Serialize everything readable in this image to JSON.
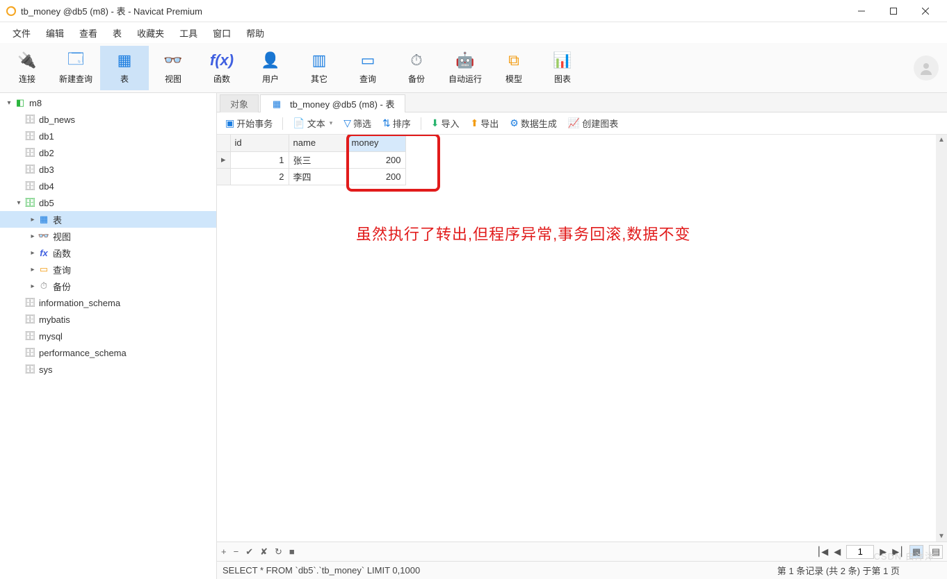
{
  "window": {
    "title": "tb_money @db5 (m8) - 表 - Navicat Premium"
  },
  "menu": [
    "文件",
    "编辑",
    "查看",
    "表",
    "收藏夹",
    "工具",
    "窗口",
    "帮助"
  ],
  "ribbon": [
    {
      "name": "connect",
      "label": "连接",
      "color": "#1b7de0"
    },
    {
      "name": "newquery",
      "label": "新建查询",
      "color": "#1b7de0"
    },
    {
      "name": "table",
      "label": "表",
      "color": "#1b7de0",
      "active": true
    },
    {
      "name": "view",
      "label": "视图",
      "color": "#1b7de0"
    },
    {
      "name": "function",
      "label": "函数",
      "color": "#4060e0"
    },
    {
      "name": "user",
      "label": "用户",
      "color": "#f29d1e"
    },
    {
      "name": "other",
      "label": "其它",
      "color": "#1b7de0"
    },
    {
      "name": "query",
      "label": "查询",
      "color": "#1b7de0"
    },
    {
      "name": "backup",
      "label": "备份",
      "color": "#78828b"
    },
    {
      "name": "auto",
      "label": "自动运行",
      "color": "#2bb56f"
    },
    {
      "name": "model",
      "label": "模型",
      "color": "#f39c12"
    },
    {
      "name": "chart",
      "label": "图表",
      "color": "#c0392b"
    }
  ],
  "tree": {
    "connection": "m8",
    "databases": [
      "db_news",
      "db1",
      "db2",
      "db3",
      "db4"
    ],
    "open_db": "db5",
    "db5_children": [
      {
        "name": "表",
        "icon": "table",
        "selected": true,
        "expand": true
      },
      {
        "name": "视图",
        "icon": "view",
        "expand": true
      },
      {
        "name": "函数",
        "icon": "fx",
        "expand": true
      },
      {
        "name": "查询",
        "icon": "query",
        "expand": true
      },
      {
        "name": "备份",
        "icon": "backup",
        "expand": true
      }
    ],
    "after": [
      "information_schema",
      "mybatis",
      "mysql",
      "performance_schema",
      "sys"
    ]
  },
  "tabs": {
    "obj": "对象",
    "active": "tb_money @db5 (m8) - 表"
  },
  "toolbar": {
    "begin": "开始事务",
    "text": "文本",
    "filter": "筛选",
    "sort": "排序",
    "import": "导入",
    "export": "导出",
    "gen": "数据生成",
    "create_chart": "创建图表"
  },
  "grid": {
    "columns": [
      "id",
      "name",
      "money"
    ],
    "rows": [
      {
        "id": "1",
        "name": "张三",
        "money": "200"
      },
      {
        "id": "2",
        "name": "李四",
        "money": "200"
      }
    ]
  },
  "annotation": "虽然执行了转出,但程序异常,事务回滚,数据不变",
  "footer_nav": {
    "page": "1"
  },
  "status": {
    "sql": "SELECT * FROM `db5`.`tb_money` LIMIT 0,1000",
    "records": "第 1 条记录 (共 2 条) 于第 1 页"
  },
  "watermark": "CSDN 白沐沐"
}
